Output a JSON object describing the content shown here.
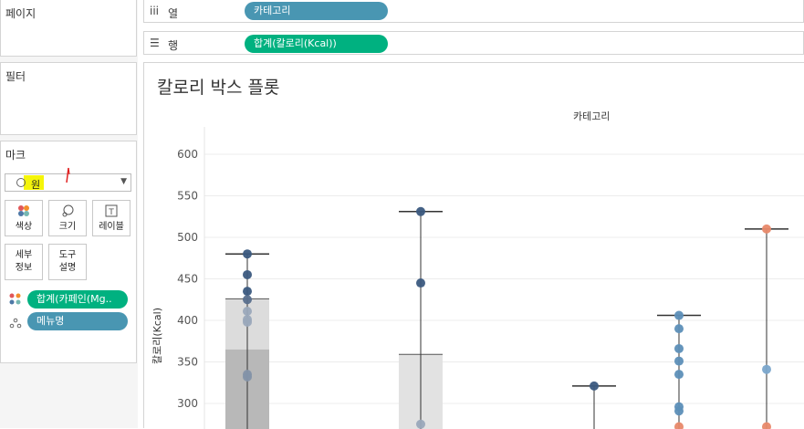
{
  "left": {
    "pages_title": "페이지",
    "filters_title": "필터",
    "marks": {
      "title": "마크",
      "mark_type": "원",
      "buttons": [
        {
          "label": "색상",
          "icon": "color-icon"
        },
        {
          "label": "크기",
          "icon": "size-icon"
        },
        {
          "label": "레이블",
          "icon": "label-icon"
        },
        {
          "label": "세부\n정보",
          "icon": "detail-icon"
        },
        {
          "label": "도구\n설명",
          "icon": "tooltip-icon"
        }
      ],
      "fields": [
        {
          "icon": "color-dots-icon",
          "label": "합계(카페인(Mg..",
          "color": "#00b180"
        },
        {
          "icon": "detail-dots-icon",
          "label": "메뉴명",
          "color": "#4996b2"
        }
      ]
    }
  },
  "shelves": {
    "columns": {
      "icon": "columns-icon",
      "label": "열",
      "pill": "카테고리",
      "pill_color": "#4996b2"
    },
    "rows": {
      "icon": "rows-icon",
      "label": "행",
      "pill": "합계(칼로리(Kcal))",
      "pill_color": "#00b180"
    }
  },
  "viz": {
    "title": "칼로리 박스 플롯",
    "column_header": "카테고리"
  },
  "chart_data": {
    "type": "scatter",
    "title": "칼로리 박스 플롯",
    "xlabel": "카테고리",
    "ylabel": "칼로리(Kcal)",
    "y_ticks": [
      300,
      350,
      400,
      450,
      500,
      550,
      600
    ],
    "ylim": [
      272,
      625
    ],
    "grid": true,
    "columns": [
      {
        "whisker_top": 480,
        "box": {
          "top": 426,
          "median": 365,
          "bottom": 0
        },
        "points": [
          {
            "y": 480,
            "color": "#3b5a80"
          },
          {
            "y": 455,
            "color": "#3b5a80"
          },
          {
            "y": 435,
            "color": "#3b5a80"
          },
          {
            "y": 425,
            "color": "#596f8d"
          },
          {
            "y": 411,
            "color": "#9aa8bb"
          },
          {
            "y": 401,
            "color": "#9aa8bb"
          },
          {
            "y": 398,
            "color": "#9aa8bb"
          },
          {
            "y": 335,
            "color": "#8392a8"
          },
          {
            "y": 332,
            "color": "#8392a8"
          }
        ]
      },
      {
        "whisker_top": 531,
        "box": {
          "top": 359,
          "median": 0,
          "bottom": 0
        },
        "points": [
          {
            "y": 531,
            "color": "#3b5a80"
          },
          {
            "y": 445,
            "color": "#3b5a80"
          },
          {
            "y": 275,
            "color": "#9aa8bb"
          }
        ]
      },
      {
        "whisker_top": 321,
        "box": null,
        "points": [
          {
            "y": 321,
            "color": "#3b5a80"
          }
        ]
      },
      {
        "whisker_top": 406,
        "box": null,
        "points": [
          {
            "y": 406,
            "color": "#5d8fb8"
          },
          {
            "y": 390,
            "color": "#5d8fb8"
          },
          {
            "y": 366,
            "color": "#5d8fb8"
          },
          {
            "y": 351,
            "color": "#5d8fb8"
          },
          {
            "y": 335,
            "color": "#5d8fb8"
          },
          {
            "y": 296,
            "color": "#5d8fb8"
          },
          {
            "y": 291,
            "color": "#5d8fb8"
          },
          {
            "y": 272,
            "color": "#e8896a"
          }
        ]
      },
      {
        "whisker_top": 510,
        "box": null,
        "points": [
          {
            "y": 510,
            "color": "#e8896a"
          },
          {
            "y": 341,
            "color": "#7ba7cc"
          },
          {
            "y": 272,
            "color": "#e8896a"
          }
        ]
      }
    ]
  }
}
